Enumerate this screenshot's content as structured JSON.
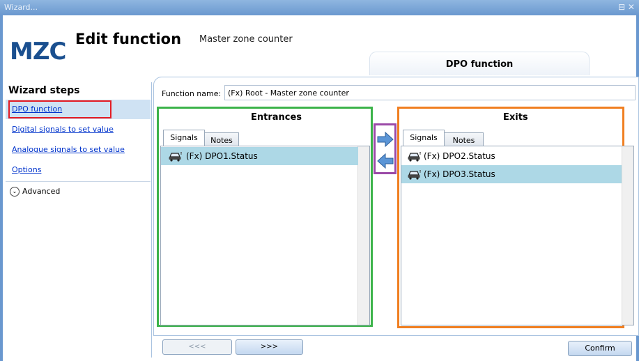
{
  "window": {
    "title": "Wizard...",
    "controls": "⊟ ✕"
  },
  "header": {
    "logo": "MZC",
    "title": "Edit function",
    "subtitle": "Master zone counter",
    "active_tab": "DPO function"
  },
  "sidebar": {
    "title": "Wizard steps",
    "items": [
      {
        "label": "DPO function"
      },
      {
        "label": "Digital signals to set value"
      },
      {
        "label": "Analogue signals to set value"
      },
      {
        "label": "Options"
      }
    ],
    "advanced": "Advanced"
  },
  "form": {
    "function_name_label": "Function name:",
    "function_name_value": "(Fx) Root - Master zone counter"
  },
  "entrances": {
    "title": "Entrances",
    "tabs": [
      "Signals",
      "Notes"
    ],
    "items": [
      "(Fx) DPO1.Status"
    ]
  },
  "exits": {
    "title": "Exits",
    "tabs": [
      "Signals",
      "Notes"
    ],
    "items": [
      "(Fx) DPO2.Status",
      "(Fx) DPO3.Status"
    ]
  },
  "nav": {
    "prev": "<<<",
    "next": ">>>",
    "confirm": "Confirm"
  },
  "colors": {
    "accent": "#1a4f8f",
    "selection": "#add8e6",
    "entrances_border": "#3cb34a",
    "exits_border": "#f07f21",
    "arrows_border": "#9b4aa7",
    "active_step_border": "#e41b23"
  }
}
